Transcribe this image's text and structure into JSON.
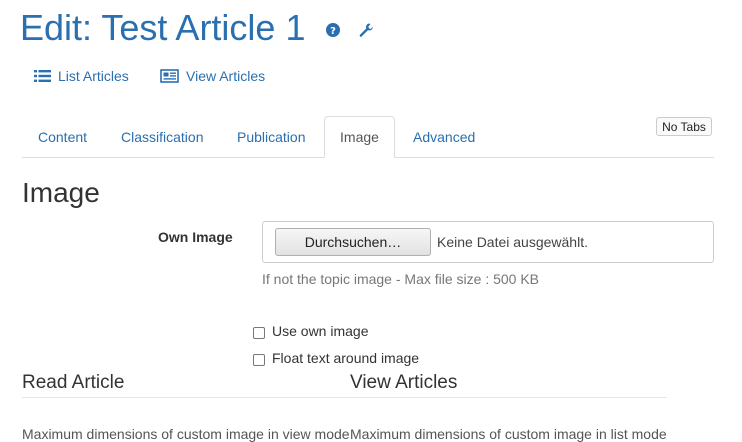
{
  "header": {
    "title": "Edit: Test Article 1",
    "icons": [
      "question-circle-icon",
      "wrench-icon"
    ]
  },
  "toolbar": {
    "list_articles": "List Articles",
    "view_articles": "View Articles"
  },
  "no_tabs_label": "No Tabs",
  "tabs": [
    {
      "label": "Content",
      "active": false
    },
    {
      "label": "Classification",
      "active": false
    },
    {
      "label": "Publication",
      "active": false
    },
    {
      "label": "Image",
      "active": true
    },
    {
      "label": "Advanced",
      "active": false
    }
  ],
  "section": {
    "heading": "Image",
    "own_image": {
      "label": "Own Image",
      "browse_button": "Durchsuchen…",
      "no_file": "Keine Datei ausgewählt.",
      "help": "If not the topic image - Max file size : 500 KB"
    },
    "checkboxes": [
      {
        "label": "Use own image",
        "checked": false
      },
      {
        "label": "Float text around image",
        "checked": false
      }
    ],
    "read_article": {
      "heading": "Read Article",
      "max_dimensions": "Maximum dimensions of custom image in view mode"
    },
    "view_articles": {
      "heading": "View Articles",
      "max_dimensions": "Maximum dimensions of custom image in list mode"
    }
  },
  "colors": {
    "link": "#2a6fb0",
    "border": "#dddddd",
    "help_text": "#777777"
  }
}
